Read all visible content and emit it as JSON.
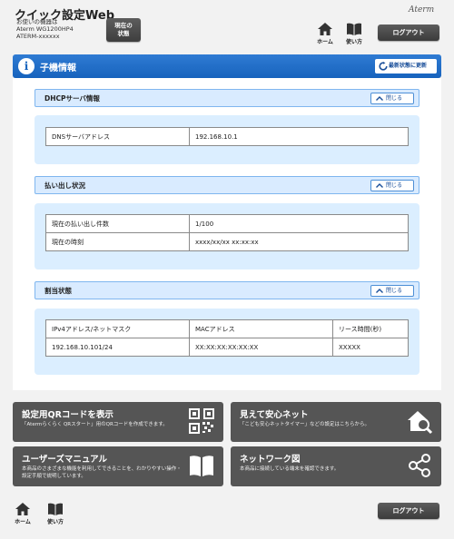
{
  "header": {
    "app_title": "クイック設定Web",
    "device_label": "お使いの機器は",
    "device_model": "Aterm WG1200HP4",
    "device_id": "ATERM-xxxxxx",
    "status_button": "現在の状態",
    "logo": "Aterm",
    "home_label": "ホーム",
    "manual_label": "使い方",
    "logout_label": "ログアウト"
  },
  "page": {
    "title": "子機情報",
    "refresh_label": "最新状態に更新"
  },
  "sections": {
    "dhcp": {
      "title": "DHCPサーバ情報",
      "close_label": "閉じる",
      "rows": [
        {
          "label": "DNSサーバアドレス",
          "value": "192.168.10.1"
        }
      ]
    },
    "payout": {
      "title": "払い出し状況",
      "close_label": "閉じる",
      "rows": [
        {
          "label": "現在の払い出し件数",
          "value": "1/100"
        },
        {
          "label": "現在の時刻",
          "value": "xxxx/xx/xx xx:xx:xx"
        }
      ]
    },
    "assign": {
      "title": "割当状態",
      "close_label": "閉じる",
      "columns": [
        "IPv4アドレス/ネットマスク",
        "MACアドレス",
        "リース時間(秒)"
      ],
      "rows": [
        [
          "192.168.10.101/24",
          "XX:XX:XX:XX:XX:XX",
          "XXXXX"
        ]
      ]
    }
  },
  "tiles": [
    {
      "title": "設定用QRコードを表示",
      "desc": "「Atermらくらく QRスタート」用のQRコードを作成できます。",
      "icon": "qr-code-icon"
    },
    {
      "title": "見えて安心ネット",
      "desc": "「こども安心ネットタイマー」などの設定はこちらから。",
      "icon": "home-search-icon"
    },
    {
      "title": "ユーザーズマニュアル",
      "desc": "本商品のさまざまな機能を利用してできることを、わかりやすい操作・設定手順で説明しています。",
      "icon": "book-icon"
    },
    {
      "title": "ネットワーク図",
      "desc": "本商品に接続している端末を確認できます。",
      "icon": "share-network-icon"
    }
  ],
  "footer": {
    "home_label": "ホーム",
    "manual_label": "使い方",
    "logout_label": "ログアウト"
  },
  "colors": {
    "accent": "#1a6fcf",
    "section_head": "#d9ebff",
    "section_body": "#dbeeff",
    "tile_bg": "#555555"
  }
}
